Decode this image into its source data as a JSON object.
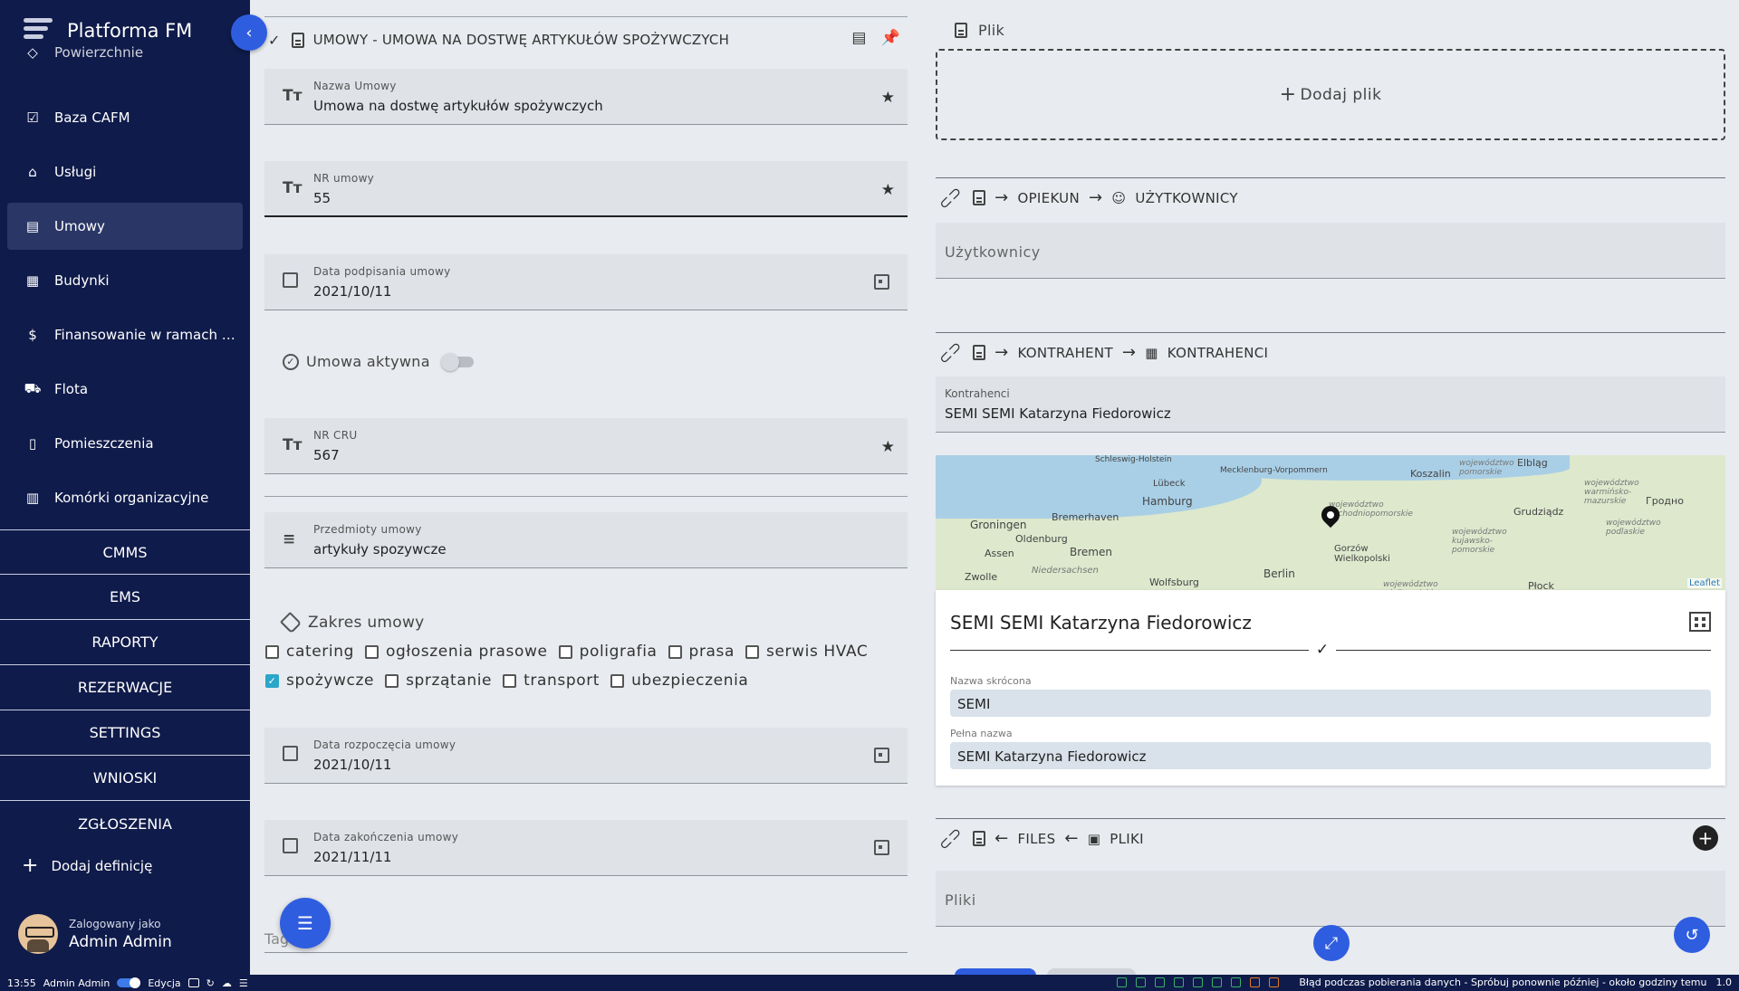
{
  "app": {
    "name": "Platforma FM"
  },
  "sidebar": {
    "items": [
      {
        "label": "Powierzchnie",
        "icon": "layers-icon"
      },
      {
        "label": "Baza CAFM",
        "icon": "checklist-icon"
      },
      {
        "label": "Usługi",
        "icon": "broom-icon"
      },
      {
        "label": "Umowy",
        "icon": "document-icon",
        "active": true
      },
      {
        "label": "Budynki",
        "icon": "building-icon"
      },
      {
        "label": "Finansowanie w ramach p...",
        "icon": "invoice-icon"
      },
      {
        "label": "Flota",
        "icon": "car-icon"
      },
      {
        "label": "Pomieszczenia",
        "icon": "door-icon"
      },
      {
        "label": "Komórki organizacyjne",
        "icon": "organization-icon"
      }
    ],
    "groups": [
      "CMMS",
      "EMS",
      "RAPORTY",
      "REZERWACJE",
      "SETTINGS",
      "WNIOSKI",
      "ZGŁOSZENIA"
    ],
    "add_definition": "Dodaj definicję",
    "user": {
      "caption": "Zalogowany jako",
      "name": "Admin Admin"
    }
  },
  "form": {
    "title": "UMOWY - UMOWA NA DOSTWĘ ARTYKUŁÓW SPOŻYWCZYCH",
    "fields": {
      "nazwa": {
        "label": "Nazwa Umowy",
        "value": "Umowa na dostwę artykułów spożywczych"
      },
      "nr": {
        "label": "NR umowy",
        "value": "55"
      },
      "data_podpisania": {
        "label": "Data podpisania umowy",
        "value": "2021/10/11"
      },
      "aktywna": {
        "label": "Umowa aktywna",
        "value": false
      },
      "nr_cru": {
        "label": "NR CRU",
        "value": "567"
      },
      "przedmioty": {
        "label": "Przedmioty umowy",
        "value": "artykuły spozywcze"
      },
      "data_rozpoczecia": {
        "label": "Data rozpoczęcia umowy",
        "value": "2021/10/11"
      },
      "data_zakonczenia": {
        "label": "Data zakończenia umowy",
        "value": "2021/11/11"
      }
    },
    "zakres": {
      "label": "Zakres umowy",
      "options_row1": [
        {
          "label": "catering",
          "checked": false
        },
        {
          "label": "ogłoszenia prasowe",
          "checked": false
        },
        {
          "label": "poligrafia",
          "checked": false
        },
        {
          "label": "prasa",
          "checked": false
        },
        {
          "label": "serwis HVAC",
          "checked": false
        }
      ],
      "options_row2": [
        {
          "label": "spożywcze",
          "checked": true
        },
        {
          "label": "sprzątanie",
          "checked": false
        },
        {
          "label": "transport",
          "checked": false
        },
        {
          "label": "ubezpieczenia",
          "checked": false
        }
      ]
    },
    "tagi_placeholder": "Tagi"
  },
  "right": {
    "plik": {
      "label": "Plik",
      "add": "Dodaj plik"
    },
    "opiekun": {
      "rel": "OPIEKUN",
      "target": "UŻYTKOWNICY",
      "placeholder": "Użytkownicy"
    },
    "kontrahent": {
      "rel": "KONTRAHENT",
      "target": "KONTRAHENCI",
      "field_label": "Kontrahenci",
      "value": "SEMI SEMI Katarzyna Fiedorowicz"
    },
    "map": {
      "labels": [
        "Schleswig-Holstein",
        "Mecklenburg-Vorpommern",
        "Lübeck",
        "Hamburg",
        "Groningen",
        "Bremerhaven",
        "Oldenburg",
        "Bremen",
        "Assen",
        "Zwolle",
        "Niedersachsen",
        "Wolfsburg",
        "Berlin",
        "Gorzów Wielkopolski",
        "Koszalin",
        "Elbląg",
        "Grudziądz",
        "Płock",
        "Гродно"
      ],
      "regions": [
        "województwo pomorskie",
        "województwo zachodniopomorskie",
        "województwo kujawsko-pomorskie",
        "województwo warmińsko-mazurskie",
        "województwo podlaskie",
        "województwo wielkopolskie"
      ],
      "attribution": "Leaflet"
    },
    "card": {
      "title": "SEMI SEMI Katarzyna Fiedorowicz",
      "short_label": "Nazwa skrócona",
      "short_value": "SEMI",
      "full_label": "Pełna nazwa",
      "full_value": "SEMI Katarzyna Fiedorowicz"
    },
    "files": {
      "rel": "FILES",
      "target": "PLIKI",
      "placeholder": "Pliki"
    }
  },
  "statusbar": {
    "time": "13:55",
    "user": "Admin Admin",
    "mode": "Edycja",
    "message": "Błąd podczas pobierania danych - Spróbuj ponownie później - około godziny temu",
    "version": "1.0"
  },
  "colors": {
    "sidebar": "#0f1b4a",
    "accent": "#2f5de0",
    "checkbox": "#2aa6c8"
  }
}
